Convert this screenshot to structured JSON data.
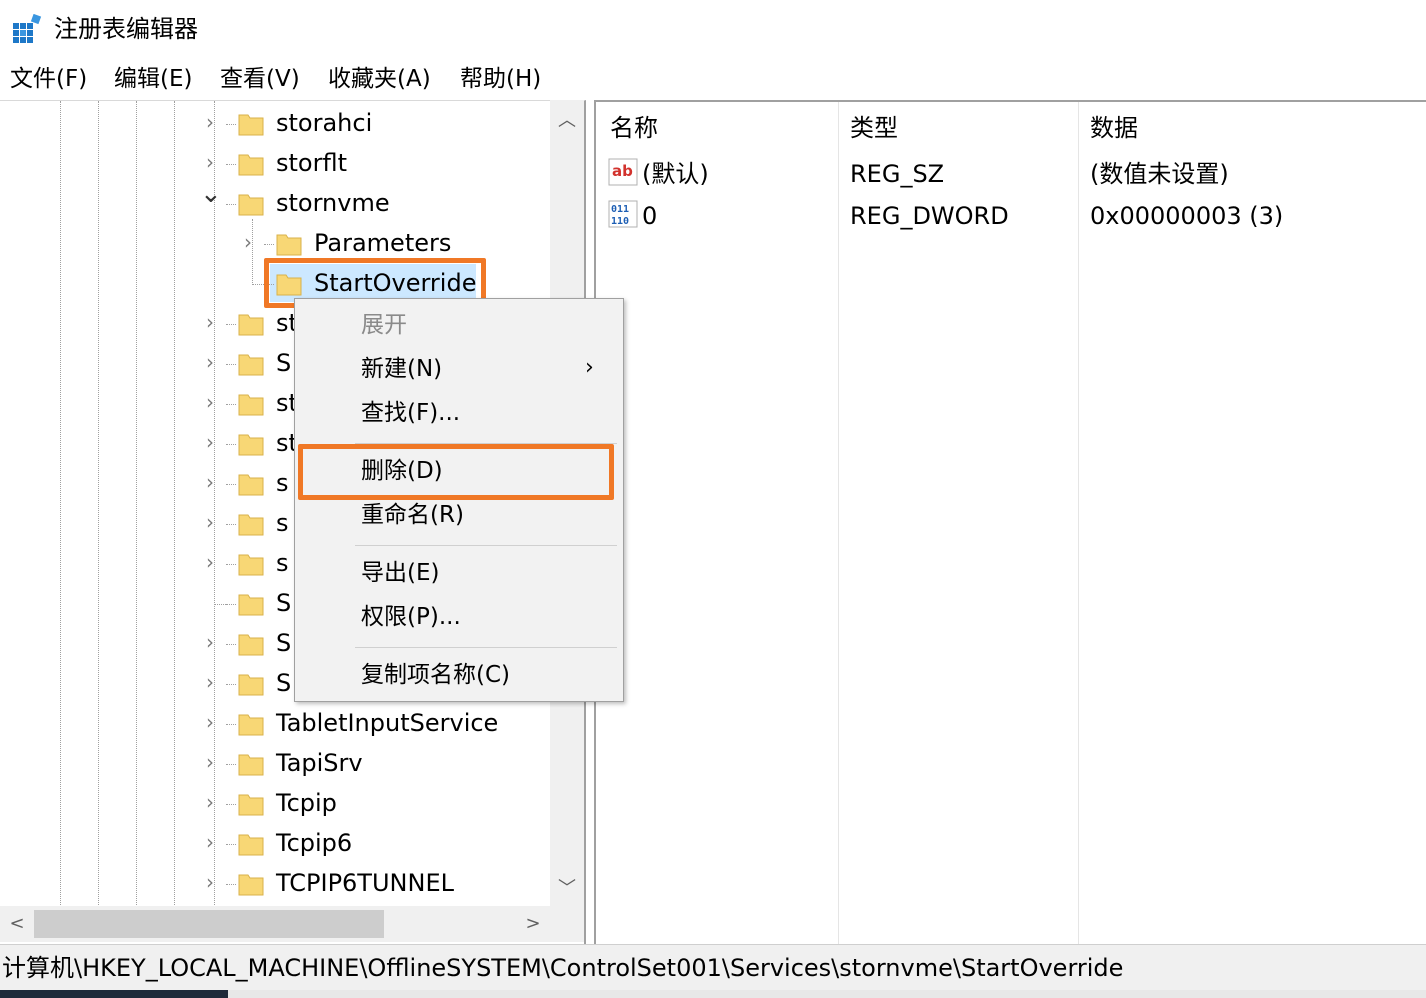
{
  "window": {
    "title": "注册表编辑器",
    "app_icon": "registry-editor-icon"
  },
  "menubar": {
    "items": [
      "文件(F)",
      "编辑(E)",
      "查看(V)",
      "收藏夹(A)",
      "帮助(H)"
    ]
  },
  "tree": {
    "items": [
      {
        "label": "storahci",
        "expander": "collapsed"
      },
      {
        "label": "storflt",
        "expander": "collapsed"
      },
      {
        "label": "stornvme",
        "expander": "expanded"
      },
      {
        "label": "Parameters",
        "expander": "collapsed"
      },
      {
        "label": "StartOverride",
        "expander": "none",
        "selected": true
      },
      {
        "label": "st",
        "expander": "collapsed"
      },
      {
        "label": "S",
        "expander": "collapsed"
      },
      {
        "label": "st",
        "expander": "collapsed"
      },
      {
        "label": "st",
        "expander": "collapsed"
      },
      {
        "label": "s",
        "expander": "collapsed"
      },
      {
        "label": "s",
        "expander": "collapsed"
      },
      {
        "label": "s",
        "expander": "collapsed"
      },
      {
        "label": "S",
        "expander": "none"
      },
      {
        "label": "S",
        "expander": "collapsed"
      },
      {
        "label": "S",
        "expander": "collapsed"
      },
      {
        "label": "TabletInputService",
        "expander": "collapsed"
      },
      {
        "label": "TapiSrv",
        "expander": "collapsed"
      },
      {
        "label": "Tcpip",
        "expander": "collapsed"
      },
      {
        "label": "Tcpip6",
        "expander": "collapsed"
      },
      {
        "label": "TCPIP6TUNNEL",
        "expander": "collapsed"
      }
    ]
  },
  "list": {
    "headers": {
      "name": "名称",
      "type": "类型",
      "data": "数据"
    },
    "rows": [
      {
        "icon": "string-value-icon",
        "icon_text": "ab",
        "name": "(默认)",
        "type": "REG_SZ",
        "data": "(数值未设置)"
      },
      {
        "icon": "binary-value-icon",
        "icon_text": "011 110",
        "name": "0",
        "type": "REG_DWORD",
        "data": "0x00000003 (3)"
      }
    ]
  },
  "context_menu": {
    "expand": "展开",
    "new": "新建(N)",
    "find": "查找(F)...",
    "delete": "删除(D)",
    "rename": "重命名(R)",
    "export": "导出(E)",
    "permissions": "权限(P)...",
    "copy_key_name": "复制项名称(C)"
  },
  "statusbar": {
    "path": "计算机\\HKEY_LOCAL_MACHINE\\OfflineSYSTEM\\ControlSet001\\Services\\stornvme\\StartOverride"
  },
  "colors": {
    "highlight": "#f07826",
    "selection": "#cce8ff",
    "folder": "#f8d775"
  }
}
